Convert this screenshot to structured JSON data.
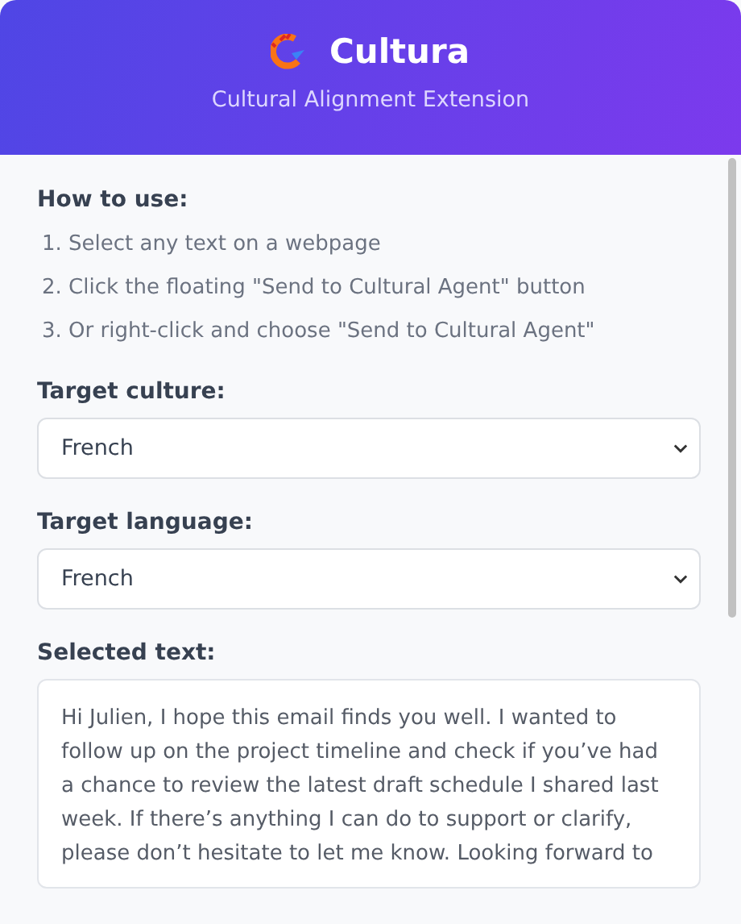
{
  "header": {
    "title": "Cultura",
    "subtitle": "Cultural Alignment Extension"
  },
  "instructions": {
    "heading": "How to use:",
    "steps": [
      "1. Select any text on a webpage",
      "2. Click the floating \"Send to Cultural Agent\" button",
      "3. Or right-click and choose \"Send to Cultural Agent\""
    ]
  },
  "fields": [
    {
      "kind": "select",
      "label": "Target culture:",
      "value": "French"
    },
    {
      "kind": "select",
      "label": "Target language:",
      "value": "French"
    },
    {
      "kind": "text",
      "label": "Selected text:",
      "value": "Hi Julien, I hope this email finds you well. I wanted to follow up on the project timeline and check if you’ve had a chance to review the latest draft schedule I shared last week. If there’s anything I can do to support or clarify, please don’t hesitate to let me know. Looking forward to"
    }
  ]
}
